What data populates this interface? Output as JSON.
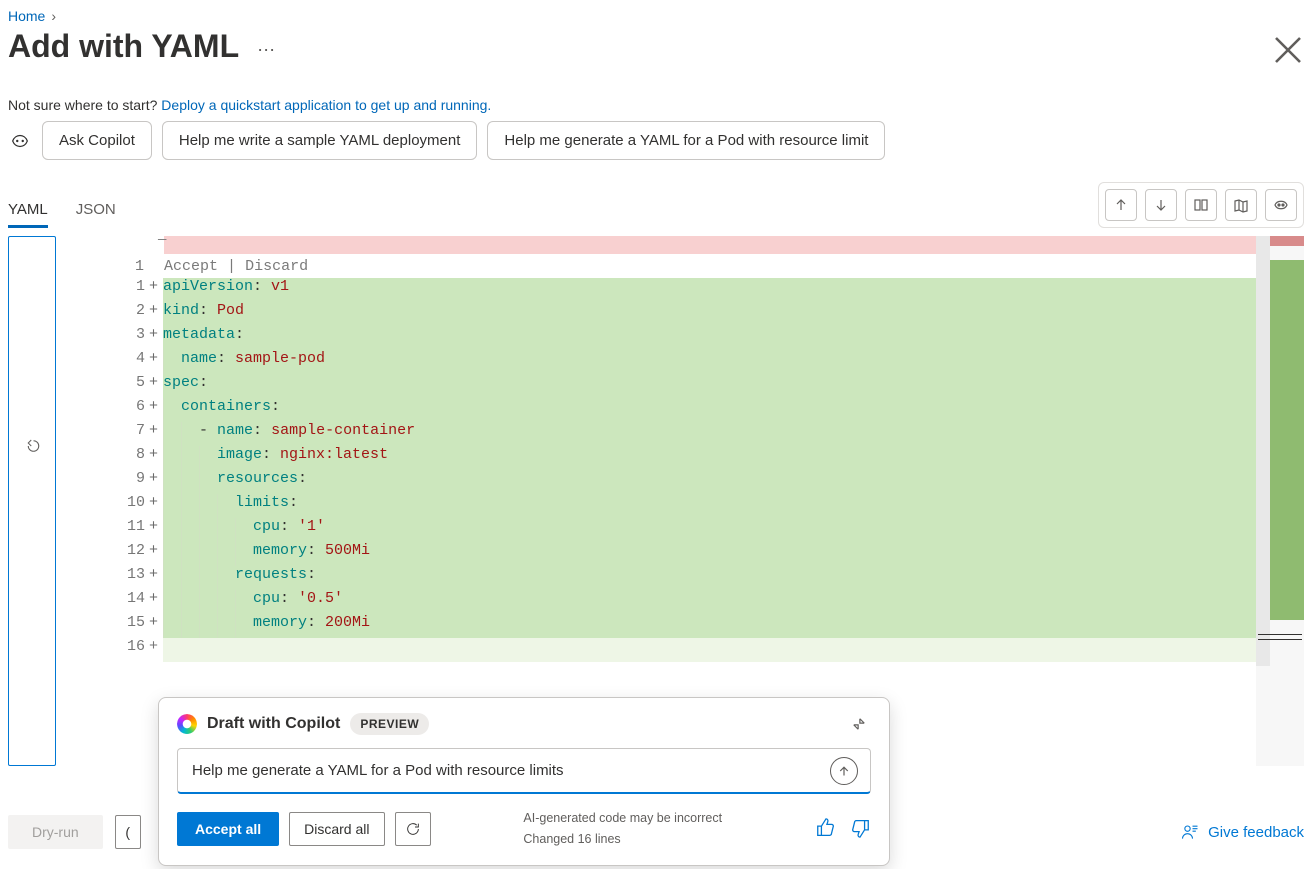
{
  "breadcrumb": {
    "home": "Home"
  },
  "page_title": "Add with YAML",
  "hint": {
    "prefix": "Not sure where to start?  ",
    "link": "Deploy a quickstart application to get up and running."
  },
  "suggestions": {
    "icon": "copilot-icon",
    "items": [
      "Ask Copilot",
      "Help me write a sample YAML deployment",
      "Help me generate a YAML for a Pod with resource limit"
    ]
  },
  "tabs": {
    "items": [
      "YAML",
      "JSON"
    ],
    "active": 0
  },
  "toolbar_icons": [
    "upload-icon",
    "download-icon",
    "compare-icon",
    "map-icon",
    "copilot-icon"
  ],
  "diff": {
    "accept_label": "Accept",
    "discard_label": "Discard",
    "separator": "|"
  },
  "code_lines": [
    {
      "n": 1,
      "tokens": [
        [
          "k",
          "apiVersion"
        ],
        [
          "",
          ":"
        ],
        [
          "",
          " "
        ],
        [
          "s",
          "v1"
        ]
      ]
    },
    {
      "n": 2,
      "tokens": [
        [
          "k",
          "kind"
        ],
        [
          "",
          ":"
        ],
        [
          "",
          " "
        ],
        [
          "s",
          "Pod"
        ]
      ]
    },
    {
      "n": 3,
      "tokens": [
        [
          "k",
          "metadata"
        ],
        [
          "",
          ":"
        ]
      ]
    },
    {
      "n": 4,
      "tokens": [
        [
          "",
          "  "
        ],
        [
          "k",
          "name"
        ],
        [
          "",
          ":"
        ],
        [
          "",
          " "
        ],
        [
          "s",
          "sample-pod"
        ]
      ]
    },
    {
      "n": 5,
      "tokens": [
        [
          "k",
          "spec"
        ],
        [
          "",
          ":"
        ]
      ]
    },
    {
      "n": 6,
      "tokens": [
        [
          "",
          "  "
        ],
        [
          "k",
          "containers"
        ],
        [
          "",
          ":"
        ]
      ]
    },
    {
      "n": 7,
      "tokens": [
        [
          "",
          "    "
        ],
        [
          "",
          "- "
        ],
        [
          "k",
          "name"
        ],
        [
          "",
          ":"
        ],
        [
          "",
          " "
        ],
        [
          "s",
          "sample-container"
        ]
      ]
    },
    {
      "n": 8,
      "tokens": [
        [
          "",
          "      "
        ],
        [
          "k",
          "image"
        ],
        [
          "",
          ":"
        ],
        [
          "",
          " "
        ],
        [
          "s",
          "nginx:latest"
        ]
      ]
    },
    {
      "n": 9,
      "tokens": [
        [
          "",
          "      "
        ],
        [
          "k",
          "resources"
        ],
        [
          "",
          ":"
        ]
      ]
    },
    {
      "n": 10,
      "tokens": [
        [
          "",
          "        "
        ],
        [
          "k",
          "limits"
        ],
        [
          "",
          ":"
        ]
      ]
    },
    {
      "n": 11,
      "tokens": [
        [
          "",
          "          "
        ],
        [
          "k",
          "cpu"
        ],
        [
          "",
          ":"
        ],
        [
          "",
          " "
        ],
        [
          "s",
          "'1'"
        ]
      ]
    },
    {
      "n": 12,
      "tokens": [
        [
          "",
          "          "
        ],
        [
          "k",
          "memory"
        ],
        [
          "",
          ":"
        ],
        [
          "",
          " "
        ],
        [
          "s",
          "500Mi"
        ]
      ]
    },
    {
      "n": 13,
      "tokens": [
        [
          "",
          "        "
        ],
        [
          "k",
          "requests"
        ],
        [
          "",
          ":"
        ]
      ]
    },
    {
      "n": 14,
      "tokens": [
        [
          "",
          "          "
        ],
        [
          "k",
          "cpu"
        ],
        [
          "",
          ":"
        ],
        [
          "",
          " "
        ],
        [
          "s",
          "'0.5'"
        ]
      ]
    },
    {
      "n": 15,
      "tokens": [
        [
          "",
          "          "
        ],
        [
          "k",
          "memory"
        ],
        [
          "",
          ":"
        ],
        [
          "",
          " "
        ],
        [
          "s",
          "200Mi"
        ]
      ]
    }
  ],
  "trailing_line_number": 16,
  "copilot_panel": {
    "title": "Draft with Copilot",
    "badge": "PREVIEW",
    "input_value": "Help me generate a YAML for a Pod with resource limits",
    "accept_all": "Accept all",
    "discard_all": "Discard all",
    "note1": "AI-generated code may be incorrect",
    "note2": "Changed 16 lines"
  },
  "footer": {
    "dry_run": "Dry-run",
    "feedback": "Give feedback"
  }
}
